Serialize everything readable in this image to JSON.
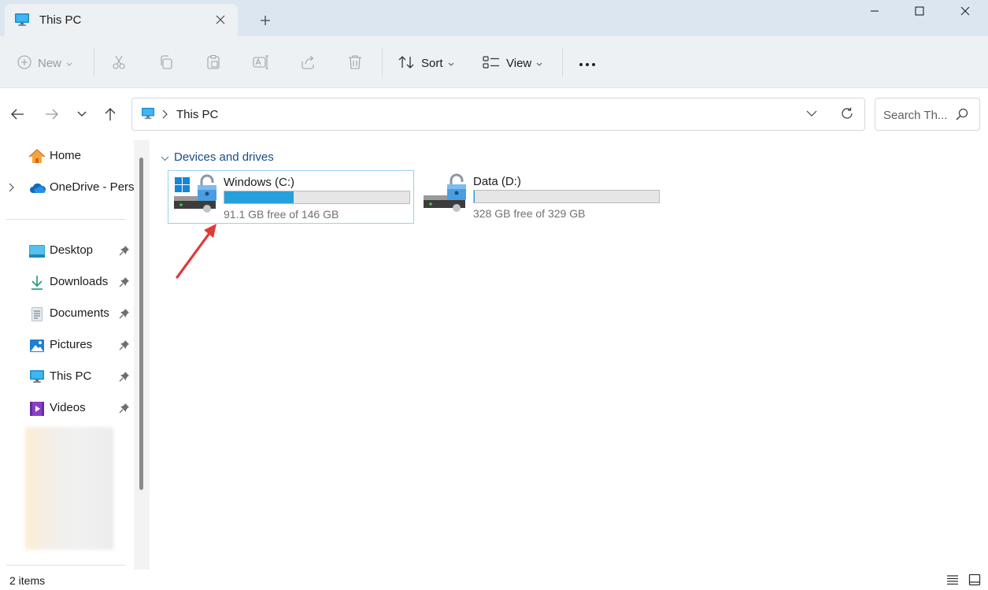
{
  "window": {
    "tab_title": "This PC",
    "tab_icon": "monitor-icon",
    "controls": [
      "minimize-icon",
      "maximize-icon",
      "close-icon"
    ]
  },
  "toolbar": {
    "new_label": "New",
    "sort_label": "Sort",
    "view_label": "View",
    "icons": [
      "cut-icon",
      "copy-icon",
      "paste-icon",
      "rename-icon",
      "share-icon",
      "delete-icon",
      "more-icon"
    ]
  },
  "address": {
    "location": "This PC",
    "search_placeholder": "Search Th..."
  },
  "sidebar": {
    "items": [
      {
        "label": "Home",
        "icon": "home-icon"
      },
      {
        "label": "OneDrive - Perso",
        "icon": "cloud-icon"
      },
      {
        "label": "Desktop",
        "icon": "desktop-folder-icon"
      },
      {
        "label": "Downloads",
        "icon": "download-icon"
      },
      {
        "label": "Documents",
        "icon": "documents-icon"
      },
      {
        "label": "Pictures",
        "icon": "pictures-icon"
      },
      {
        "label": "This PC",
        "icon": "monitor-icon"
      },
      {
        "label": "Videos",
        "icon": "videos-icon"
      }
    ]
  },
  "content": {
    "group_label": "Devices and drives",
    "drives": [
      {
        "name": "Windows (C:)",
        "info": "91.1 GB free of 146 GB",
        "used_fraction": 0.376,
        "selected": true
      },
      {
        "name": "Data (D:)",
        "info": "328 GB free of 329 GB",
        "used_fraction": 0.003,
        "selected": false
      }
    ]
  },
  "status": {
    "item_count": "2 items"
  },
  "colors": {
    "accent": "#26a0da",
    "titlebar": "#dce6f1",
    "commandbar": "#eef1f4",
    "annotation_arrow": "#e03a3a"
  }
}
